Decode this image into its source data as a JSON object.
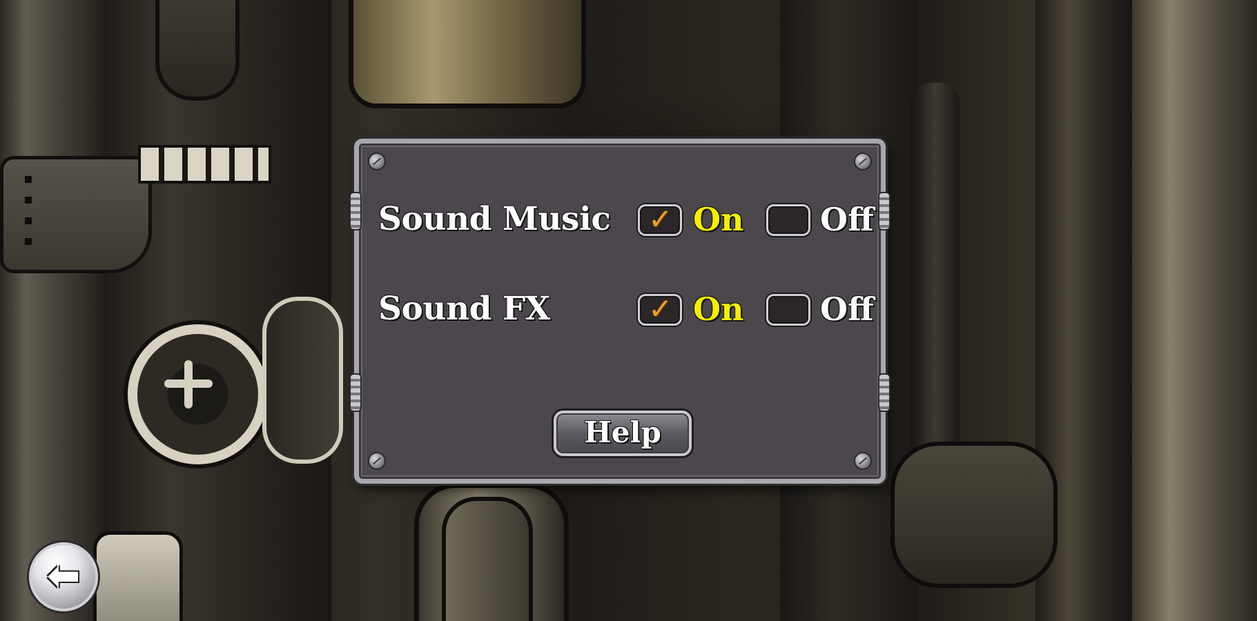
{
  "settings": {
    "rows": [
      {
        "label": "Sound Music",
        "on_label": "On",
        "off_label": "Off",
        "on_checked": true,
        "off_checked": false
      },
      {
        "label": "Sound FX",
        "on_label": "On",
        "off_label": "Off",
        "on_checked": true,
        "off_checked": false
      }
    ],
    "help_label": "Help"
  },
  "icons": {
    "checkmark": "checkmark-icon",
    "back": "back-arrow-icon"
  },
  "glyphs": {
    "checkmark": "✓",
    "back_arrow": "⬅"
  },
  "colors": {
    "panel": "#4b474c",
    "panel_border": "#a8a8ad",
    "on_text": "#f4f000",
    "off_text": "#ffffff",
    "checkmark": "#f0a020"
  }
}
